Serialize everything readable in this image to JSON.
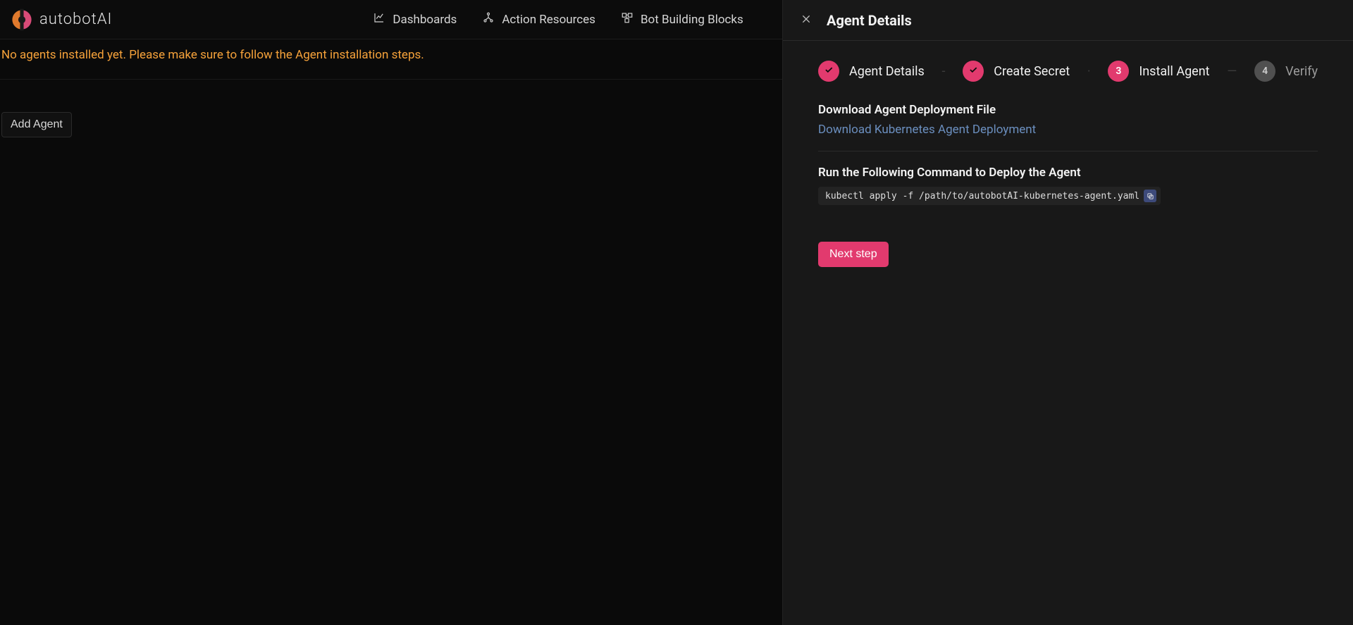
{
  "brand": {
    "name_left": "autobot",
    "name_right": "AI"
  },
  "nav": {
    "dashboards": "Dashboards",
    "action_resources": "Action Resources",
    "bot_building_blocks": "Bot Building Blocks"
  },
  "main": {
    "notice": "No agents installed yet. Please make sure to follow the Agent installation steps.",
    "add_agent": "Add Agent"
  },
  "panel": {
    "title": "Agent Details",
    "steps": {
      "s1": {
        "label": "Agent Details"
      },
      "s2": {
        "label": "Create Secret"
      },
      "s3": {
        "num": "3",
        "label": "Install Agent"
      },
      "s4": {
        "num": "4",
        "label": "Verify"
      }
    },
    "download": {
      "heading": "Download Agent Deployment File",
      "link": "Download Kubernetes Agent Deployment"
    },
    "run": {
      "heading": "Run the Following Command to Deploy the Agent",
      "command": "kubectl apply -f /path/to/autobotAI-kubernetes-agent.yaml"
    },
    "next": "Next step"
  }
}
